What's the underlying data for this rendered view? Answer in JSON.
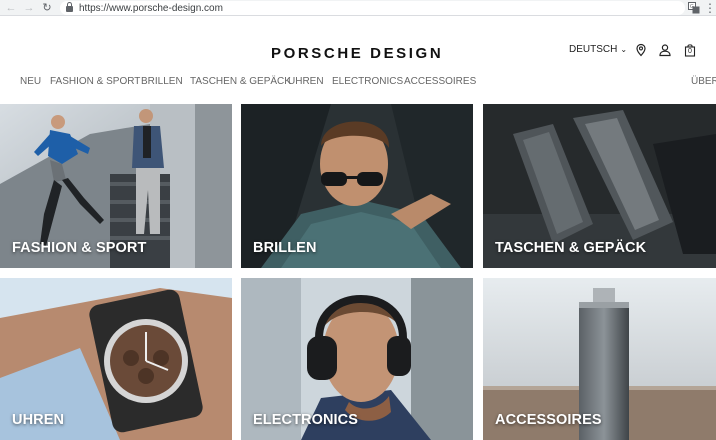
{
  "browser": {
    "url": "https://www.porsche-design.com",
    "back_icon": "arrow-left-icon",
    "forward_icon": "arrow-right-icon",
    "reload_icon": "reload-icon"
  },
  "header": {
    "logo": "PORSCHE DESIGN",
    "language": "DEUTSCH",
    "cart_count": "0"
  },
  "nav": {
    "items": [
      "NEU",
      "FASHION & SPORT",
      "BRILLEN",
      "TASCHEN & GEPÄCK",
      "UHREN",
      "ELECTRONICS",
      "ACCESSOIRES",
      "ÜBER"
    ]
  },
  "tiles": [
    {
      "label": "FASHION & SPORT"
    },
    {
      "label": "BRILLEN"
    },
    {
      "label": "TASCHEN & GEPÄCK"
    },
    {
      "label": "UHREN"
    },
    {
      "label": "ELECTRONICS"
    },
    {
      "label": "ACCESSOIRES"
    }
  ],
  "colors": {
    "browser_chrome": "#f1f3f4",
    "nav_text": "#666666",
    "logo": "#111111"
  }
}
